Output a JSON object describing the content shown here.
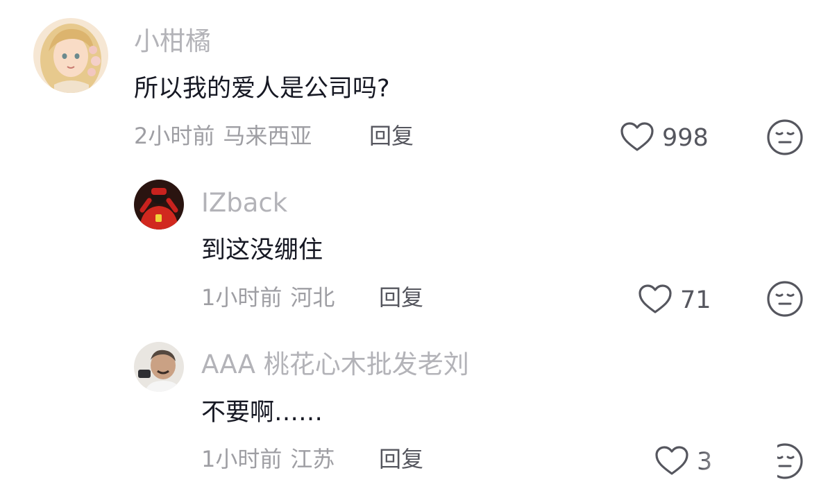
{
  "comments": [
    {
      "username": "小柑橘",
      "text": "所以我的爱人是公司吗?",
      "time": "2小时前",
      "location": "马来西亚",
      "reply_label": "回复",
      "likes": "998"
    },
    {
      "username": "IZback",
      "text": "到这没绷住",
      "time": "1小时前",
      "location": "河北",
      "reply_label": "回复",
      "likes": "71"
    },
    {
      "username": "AAA 桃花心木批发老刘",
      "text": "不要啊……",
      "time": "1小时前",
      "location": "江苏",
      "reply_label": "回复",
      "likes": "3"
    }
  ],
  "icons": {
    "like": "heart-outline-icon",
    "dislike": "unamused-face-icon"
  },
  "colors": {
    "username": "#b3b3b8",
    "text": "#161823",
    "meta": "#9e9ea3",
    "action": "#55565e"
  }
}
